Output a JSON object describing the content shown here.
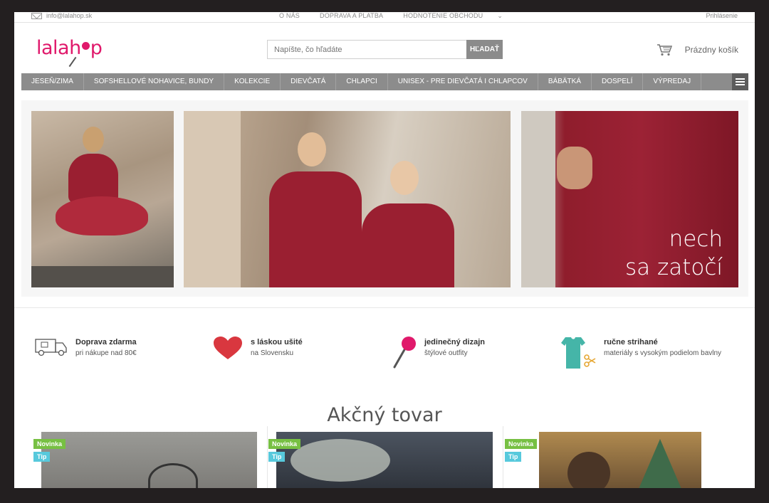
{
  "topbar": {
    "email": "info@lalahop.sk",
    "links": [
      "O NÁS",
      "DOPRAVA A PLATBA",
      "HODNOTENIE OBCHODU"
    ],
    "login": "Prihlásenie"
  },
  "header": {
    "logo_a": "lala",
    "logo_b": "h",
    "logo_c": "p",
    "search_placeholder": "Napíšte, čo hľadáte",
    "search_button": "HĽADAŤ",
    "cart_label": "Prázdny košík"
  },
  "nav": {
    "items": [
      "JESEŇ/ZIMA",
      "SOFSHELLOVÉ NOHAVICE, BUNDY",
      "KOLEKCIE",
      "DIEVČATÁ",
      "CHLAPCI",
      "UNISEX - PRE DIEVČATÁ I CHLAPCOV",
      "BÁBÄTKÁ",
      "DOSPELÍ",
      "VÝPREDAJ"
    ]
  },
  "hero": {
    "caption_line1": "nech",
    "caption_line2": "sa zatočí"
  },
  "features": [
    {
      "title": "Doprava zdarma",
      "sub": "pri nákupe nad 80€",
      "icon": "delivery-truck-icon"
    },
    {
      "title": "s láskou ušité",
      "sub": "na Slovensku",
      "icon": "heart-icon"
    },
    {
      "title": "jedinečný dizajn",
      "sub": "štýlové outfity",
      "icon": "lollipop-icon"
    },
    {
      "title": "ručne strihané",
      "sub": "materiály s vysokým podielom bavlny",
      "icon": "tshirt-scissors-icon"
    }
  ],
  "products": {
    "title": "Akčný tovar",
    "badge_new": "Novinka",
    "badge_tip": "Tip"
  },
  "colors": {
    "brand": "#e0196b",
    "nav_bg": "#8c8c8c",
    "badge_new": "#77c043",
    "badge_tip": "#57c9dc"
  }
}
